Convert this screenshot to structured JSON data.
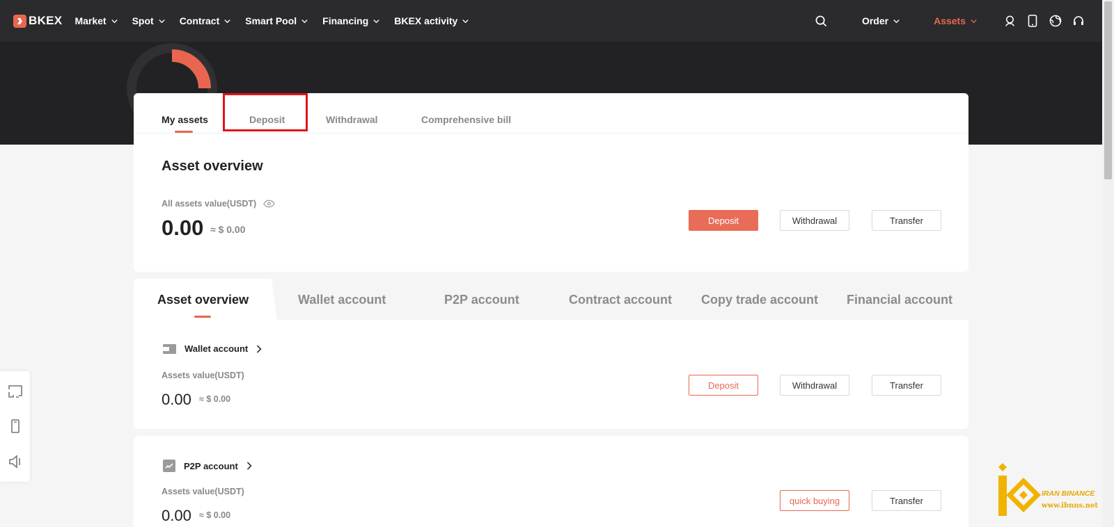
{
  "nav": {
    "logo": "BKEX",
    "items": [
      "Market",
      "Spot",
      "Contract",
      "Smart Pool",
      "Financing",
      "BKEX activity"
    ],
    "order": "Order",
    "assets": "Assets",
    "accent": "#e8664f"
  },
  "top_tabs": [
    "My assets",
    "Deposit",
    "Withdrawal",
    "Comprehensive bill"
  ],
  "overview": {
    "title": "Asset overview",
    "label": "All assets value(USDT)",
    "value": "0.00",
    "approx": "≈ $ 0.00",
    "buttons": [
      "Deposit",
      "Withdrawal",
      "Transfer"
    ]
  },
  "account_tabs": [
    "Asset overview",
    "Wallet account",
    "P2P account",
    "Contract account",
    "Copy trade account",
    "Financial account"
  ],
  "wallet": {
    "title": "Wallet account",
    "label": "Assets value(USDT)",
    "value": "0.00",
    "approx": "≈ $ 0.00",
    "buttons": [
      "Deposit",
      "Withdrawal",
      "Transfer"
    ]
  },
  "p2p": {
    "title": "P2P account",
    "label": "Assets value(USDT)",
    "value": "0.00",
    "approx": "≈ $ 0.00",
    "buttons": [
      "quick buying",
      "Transfer"
    ]
  },
  "watermark": {
    "line1": "IRAN BINANCE",
    "line2": "www.ibnns.net"
  }
}
